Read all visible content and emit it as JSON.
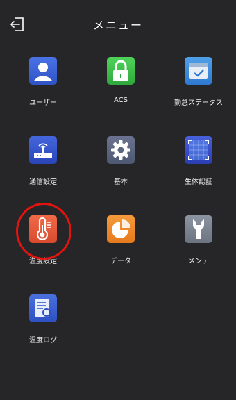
{
  "header": {
    "title": "メニュー",
    "back_icon": "exit-arrow-icon"
  },
  "menu": {
    "items": [
      {
        "label": "ユーザー",
        "icon": "user-icon",
        "color": "#3d64d8"
      },
      {
        "label": "ACS",
        "icon": "lock-icon",
        "color": "#3fbf4a"
      },
      {
        "label": "勤怠ステータス",
        "icon": "attendance-check-icon",
        "color": "#3f8fdc"
      },
      {
        "label": "通信設定",
        "icon": "network-router-icon",
        "color": "#3b58c9"
      },
      {
        "label": "基本",
        "icon": "gear-icon",
        "color": "#5d6680"
      },
      {
        "label": "生体認証",
        "icon": "face-frame-icon",
        "color": "#3a4fc8"
      },
      {
        "label": "温度設定",
        "icon": "thermometer-icon",
        "color": "#ea5a3c"
      },
      {
        "label": "データ",
        "icon": "pie-chart-icon",
        "color": "#f08a2c"
      },
      {
        "label": "メンテ",
        "icon": "wrench-icon",
        "color": "#7c8492"
      },
      {
        "label": "温度ログ",
        "icon": "log-search-icon",
        "color": "#3d62cf"
      }
    ]
  },
  "annotation": {
    "highlight_color": "#e3140f"
  }
}
